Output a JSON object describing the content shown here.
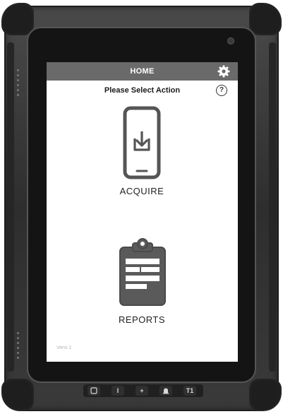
{
  "header": {
    "title": "HOME"
  },
  "screen": {
    "prompt": "Please Select Action",
    "help_symbol": "?",
    "footer_text": "Versi 1"
  },
  "actions": [
    {
      "label": "ACQUIRE",
      "icon": "phone-download-icon"
    },
    {
      "label": "REPORTS",
      "icon": "clipboard-icon"
    }
  ],
  "hardware_buttons": [
    {
      "label": "",
      "icon": "power-button"
    },
    {
      "label": "I"
    },
    {
      "label": "+"
    },
    {
      "label": "",
      "icon": "bell-icon"
    },
    {
      "label": "T1"
    }
  ],
  "colors": {
    "title_bar": "#6a6a6a",
    "icon_gray": "#555555",
    "screen_bg": "#ffffff"
  }
}
